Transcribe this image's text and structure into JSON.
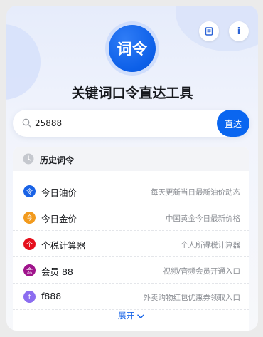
{
  "app": {
    "logo_text": "词令",
    "title": "关键词口令直达工具"
  },
  "header": {
    "doc_icon": "document-icon",
    "info_label": "i"
  },
  "search": {
    "value": "25888",
    "button_label": "直达"
  },
  "history": {
    "label": "历史词令",
    "items": [
      {
        "badge": "令",
        "name": "今日油价",
        "desc": "每天更新当日最新油价动态",
        "color": "#1a63e6"
      },
      {
        "badge": "今",
        "name": "今日金价",
        "desc": "中国黄金今日最新价格",
        "color": "#f29a1d"
      },
      {
        "badge": "个",
        "name": "个税计算器",
        "desc": "个人所得税计算器",
        "color": "#e5101d"
      },
      {
        "badge": "会",
        "name": "会员 88",
        "desc": "视频/音频会员开通入口",
        "color": "#a0148c"
      },
      {
        "badge": "f",
        "name": "f888",
        "desc": "外卖购物红包优惠券领取入口",
        "color": "#8c6df0"
      }
    ]
  },
  "footer": {
    "expand_label": "展开"
  },
  "colors": {
    "accent": "#0a66f0",
    "background": "#ebebeb"
  }
}
